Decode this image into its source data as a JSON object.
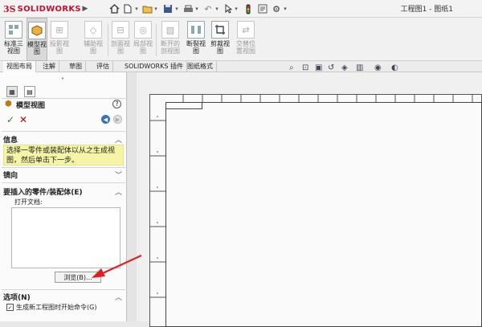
{
  "titlebar": {
    "logo_ds": "3S",
    "logo_text": "SOLIDWORKS",
    "document_title": "工程图1 - 图纸1",
    "quick_access_icons": [
      "home-icon",
      "new-document-icon",
      "open-folder-icon",
      "save-icon",
      "print-icon",
      "undo-icon",
      "select-cursor-icon",
      "rebuild-icon",
      "file-properties-icon",
      "options-gear-icon"
    ]
  },
  "ribbon": {
    "buttons": [
      {
        "label": "标准三\n视图",
        "icon": "standard-3-view-icon",
        "enabled": true,
        "active": false
      },
      {
        "label": "模型视\n图",
        "icon": "model-view-icon",
        "enabled": true,
        "active": true
      },
      {
        "label": "投影视\n图",
        "icon": "projected-view-icon",
        "enabled": false,
        "active": false
      },
      {
        "label": "辅助视\n图",
        "icon": "auxiliary-view-icon",
        "enabled": false,
        "active": false
      },
      {
        "label": "剖面视\n图",
        "icon": "section-view-icon",
        "enabled": false,
        "active": false
      },
      {
        "label": "局部视\n图",
        "icon": "detail-view-icon",
        "enabled": false,
        "active": false
      },
      {
        "label": "断开的\n剖视图",
        "icon": "broken-out-section-icon",
        "enabled": false,
        "active": false
      },
      {
        "label": "断裂视\n图",
        "icon": "break-view-icon",
        "enabled": true,
        "active": false
      },
      {
        "label": "剪裁视\n图",
        "icon": "crop-view-icon",
        "enabled": true,
        "active": false
      },
      {
        "label": "交替位\n置视图",
        "icon": "alternate-position-view-icon",
        "enabled": false,
        "active": false
      }
    ]
  },
  "tabs": [
    {
      "label": "视图布局",
      "active": true
    },
    {
      "label": "注解",
      "active": false
    },
    {
      "label": "草图",
      "active": false
    },
    {
      "label": "评估",
      "active": false
    },
    {
      "label": "SOLIDWORKS 插件",
      "active": false
    },
    {
      "label": "图纸格式",
      "active": false
    }
  ],
  "heads_up_toolbar": [
    "zoom-to-fit-icon",
    "zoom-area-icon",
    "zoom-sheet-icon",
    "previous-view-icon",
    "3d-view-icon",
    "display-style-icon",
    "hide-show-icon",
    "appearance-icon"
  ],
  "property_manager": {
    "title": "模型视图",
    "help": "?",
    "ok_icon": "check-icon",
    "cancel_icon": "close-icon",
    "info": {
      "heading": "信息",
      "message": "选择一零件或装配体以从之生成视图，然后单击下一步。"
    },
    "orientation": {
      "heading": "镜向"
    },
    "part_assembly": {
      "heading": "要插入的零件/装配体(E)",
      "open_documents_label": "打开文档:",
      "browse_label": "浏览(B)..."
    },
    "options": {
      "heading": "选项(N)",
      "start_command_label": "生成新工程图时开始命令(G)",
      "start_command_checked": true
    }
  },
  "colors": {
    "brand_red": "#c8102e",
    "info_highlight": "#f5f5a8",
    "annotation_arrow": "#e02020",
    "back_button": "#3a6fc2"
  }
}
